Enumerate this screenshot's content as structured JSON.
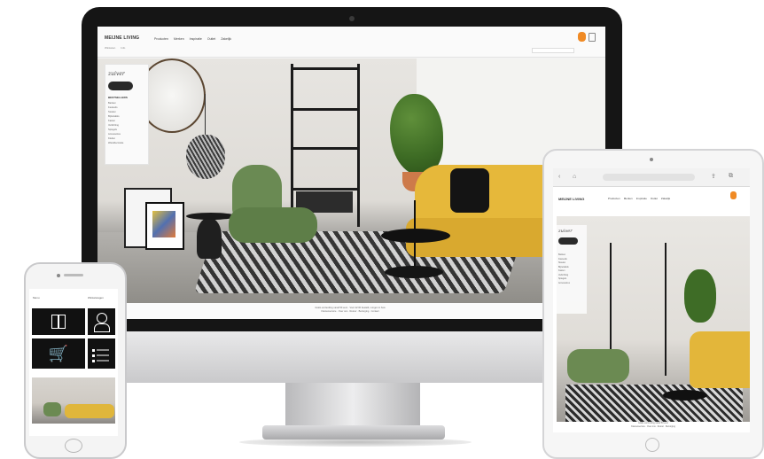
{
  "imac": {
    "site": {
      "logo": "MEIJNE LIVING",
      "nav": [
        "Producten",
        "Merken",
        "Inspiratie",
        "Outlet",
        "Zakelijk"
      ],
      "sub": [
        "Winkelen",
        "Info"
      ],
      "sidebar": {
        "script_logo": "zuiver",
        "heading": "BESTSELLERS",
        "items": [
          "Banken",
          "Fauteuils",
          "Stoelen",
          "Bijzettafels",
          "Kasten",
          "Verlichting",
          "Spiegels",
          "Accessoires",
          "Kleden",
          "Wanddecoratie"
        ]
      },
      "footer_lines": [
        "Gratis verzending vanaf 50 euro · Voor 22:00 besteld, morgen in huis",
        "Klantenservice · Over ons · Retour · Bezorging · Contact"
      ]
    }
  },
  "phone": {
    "topbar_left": "Menu",
    "topbar_right": "Winkelwagen"
  },
  "tablet": {
    "logo": "MEIJNE LIVING",
    "nav": [
      "Producten",
      "Merken",
      "Inspiratie",
      "Outlet",
      "Zakelijk"
    ],
    "sidebar": {
      "script_logo": "zuiver",
      "items": [
        "Banken",
        "Fauteuils",
        "Stoelen",
        "Bijzettafels",
        "Kasten",
        "Verlichting",
        "Spiegels",
        "Accessoires"
      ]
    },
    "footer_lines": [
      "Gratis verzending vanaf 50 euro",
      "Klantenservice · Over ons · Retour · Bezorging"
    ]
  },
  "colors": {
    "accent": "#f08a24",
    "sofa": "#e3b63a",
    "chair": "#6b8a52"
  }
}
